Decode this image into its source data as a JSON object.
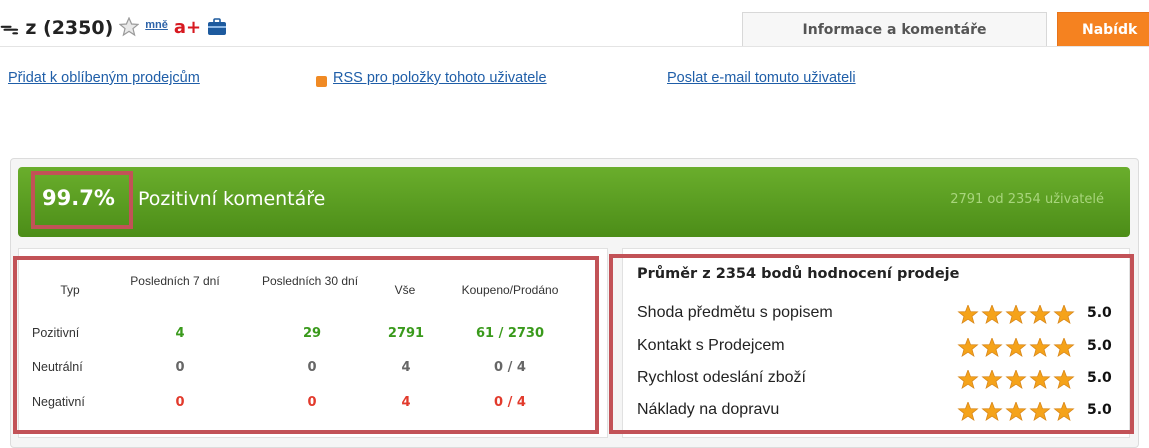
{
  "header": {
    "user": "ᯓ z (2350)",
    "me_badge": "mně",
    "aplus_badge": "a+",
    "tabs": [
      {
        "label": "Informace a komentáře"
      },
      {
        "label": "Nabídk"
      }
    ]
  },
  "links": {
    "favorite": "Přidat k oblíbeným prodejcům",
    "rss": "RSS pro položky tohoto uživatele",
    "email": "Poslat e-mail tomuto uživateli"
  },
  "summary": {
    "percent": "99.7%",
    "label": "Pozitivní komentáře",
    "count_text": "2791 od 2354 uživatelé"
  },
  "feedback_table": {
    "headers": [
      "Typ",
      "Posledních 7 dní",
      "Posledních 30 dní",
      "Vše",
      "Koupeno/Prodáno"
    ],
    "rows": [
      {
        "type": "Pozitivní",
        "d7": "4",
        "d30": "29",
        "all": "2791",
        "ratio": "61 / 2730"
      },
      {
        "type": "Neutrální",
        "d7": "0",
        "d30": "0",
        "all": "4",
        "ratio": "0 / 4"
      },
      {
        "type": "Negativní",
        "d7": "0",
        "d30": "0",
        "all": "4",
        "ratio": "0 / 4"
      }
    ]
  },
  "ratings": {
    "title": "Průměr z 2354 bodů hodnocení prodeje",
    "items": [
      {
        "label": "Shoda předmětu s popisem",
        "stars": 5,
        "value": "5.0"
      },
      {
        "label": "Kontakt s Prodejcem",
        "stars": 5,
        "value": "5.0"
      },
      {
        "label": "Rychlost odeslání zboží",
        "stars": 5,
        "value": "5.0"
      },
      {
        "label": "Náklady na dopravu",
        "stars": 5,
        "value": "5.0"
      }
    ]
  },
  "colors": {
    "banner_green": "#5a9c22",
    "highlight_frame": "#c25257",
    "positive": "#3a9a1c",
    "negative": "#e23a2c",
    "star": "#f5a31a",
    "offers_tab": "#f58220"
  }
}
